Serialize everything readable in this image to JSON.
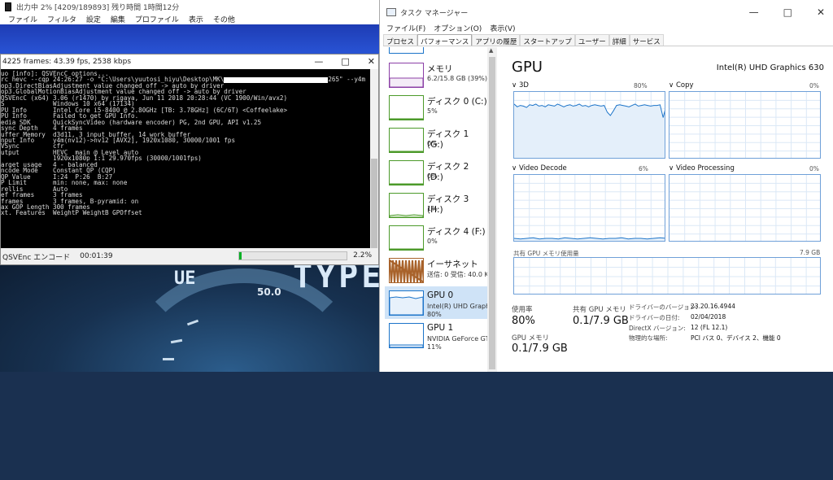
{
  "player": {
    "title": "出力中 2% [4209/189893] 残り時間 1時間12分",
    "menu": [
      "ファイル",
      "フィルタ",
      "設定",
      "編集",
      "プロファイル",
      "表示",
      "その他"
    ]
  },
  "background": {
    "overlay_text_1": "TYPE",
    "overlay_text_2": "UE",
    "gauge_labels": [
      "50.0"
    ]
  },
  "console": {
    "title": "4225 frames: 43.39 fps, 2538 kbps",
    "lines": [
      "uo [info]: QSVEncC options...",
      "rc hevc --cqp 24:26:27 -o \"C:\\Users\\yuutosi_hiyu\\Desktop\\MK\\",
      "op3.DirectBiasAdjustment value changed off -> auto by driver",
      "op3.GlobalMotionBiasAdjustment value changed off -> auto by driver",
      "QSVEncC (x64) 3.06 (r1470) by rigaya, Jun 11 2018 20:28:44 (VC 1900/Win/avx2)",
      "S             Windows 10 x64 (17134)",
      "PU Info       Intel Core i5-8400 @ 2.80GHz [TB: 3.78GHz] (6C/6T) <Coffeelake>",
      "PU Info       Failed to get GPU Info.",
      "edia SDK      QuickSyncVideo (hardware encoder) PG, 2nd GPU, API v1.25",
      "sync Depth    4 frames",
      "uffer Memory  d3d11, 3 input buffer, 14 work buffer",
      "nput Info     y4m(nv12)->nv12 [AVX2], 1920x1080, 30000/1001 fps",
      "VSync         cfr",
      "utput         HEVC  main @ Level auto",
      "              1920x1080p 1:1 29.970fps (30000/1001fps)",
      "arget usage   4 - balanced",
      "ncode Mode    Constant QP (CQP)",
      "QP Value      I:24  P:26  B:27",
      "P Limit       min: none, max: none",
      "rellis        Auto",
      "ef frames     3 frames",
      "frames        3 frames, B-pyramid: on",
      "ax GOP Length 300 frames",
      "xt. Features  WeightP WeightB GPOffset"
    ],
    "redacted_suffix": "265\" --y4m -i -",
    "status_label": "QSVEnc エンコード",
    "elapsed": "00:01:39",
    "progress_pct": 0.022,
    "progress_text": "2.2%"
  },
  "taskmgr": {
    "title": "タスク マネージャー",
    "menu": [
      "ファイル(F)",
      "オプション(O)",
      "表示(V)"
    ],
    "tabs": [
      "プロセス",
      "パフォーマンス",
      "アプリの履歴",
      "スタートアップ",
      "ユーザー",
      "詳細",
      "サービス"
    ],
    "active_tab": 1,
    "sidebar": [
      {
        "name": "メモリ",
        "sub": "6.2/15.8 GB (39%)",
        "sub2": "",
        "kind": "mem"
      },
      {
        "name": "ディスク 0 (C:)",
        "sub": "5%",
        "sub2": "",
        "kind": "disk"
      },
      {
        "name": "ディスク 1 (G:)",
        "sub": "0%",
        "sub2": "",
        "kind": "disk"
      },
      {
        "name": "ディスク 2 (D:)",
        "sub": "0%",
        "sub2": "",
        "kind": "disk"
      },
      {
        "name": "ディスク 3 (H:)",
        "sub": "1%",
        "sub2": "",
        "kind": "disk"
      },
      {
        "name": "ディスク 4 (F:)",
        "sub": "0%",
        "sub2": "",
        "kind": "disk"
      },
      {
        "name": "イーサネット",
        "sub": "送信: 0 受信: 40.0 Kb",
        "sub2": "",
        "kind": "eth"
      },
      {
        "name": "GPU 0",
        "sub": "Intel(R) UHD Graphic",
        "sub2": "80%",
        "kind": "gpu"
      },
      {
        "name": "GPU 1",
        "sub": "NVIDIA GeForce GTX",
        "sub2": "11%",
        "kind": "gpu"
      }
    ],
    "selected_index": 7,
    "main": {
      "title": "GPU",
      "model": "Intel(R) UHD Graphics 630",
      "engines": [
        {
          "label": "3D",
          "pct": "80%",
          "level": 0.8
        },
        {
          "label": "Copy",
          "pct": "0%",
          "level": 0
        },
        {
          "label": "Video Decode",
          "pct": "6%",
          "level": 0.06
        },
        {
          "label": "Video Processing",
          "pct": "0%",
          "level": 0
        }
      ],
      "shared_mem_label": "共有 GPU メモリ使用量",
      "shared_mem_max": "7.9 GB",
      "stats": {
        "util_label": "使用率",
        "util_value": "80%",
        "shared_label": "共有 GPU メモリ",
        "shared_value": "0.1/7.9 GB",
        "gpumem_label": "GPU メモリ",
        "gpumem_value": "0.1/7.9 GB"
      },
      "details": [
        {
          "k": "ドライバーのバージョン:",
          "v": "23.20.16.4944"
        },
        {
          "k": "ドライバーの日付:",
          "v": "02/04/2018"
        },
        {
          "k": "DirectX バージョン:",
          "v": "12 (FL 12.1)"
        },
        {
          "k": "物理的な場所:",
          "v": "PCI バス 0、デバイス 2、機能 0"
        }
      ],
      "graph_3d_series": [
        0.82,
        0.78,
        0.8,
        0.79,
        0.77,
        0.81,
        0.8,
        0.82,
        0.79,
        0.8,
        0.78,
        0.81,
        0.8,
        0.79,
        0.82,
        0.8,
        0.78,
        0.8,
        0.81,
        0.79,
        0.8,
        0.82,
        0.79,
        0.8,
        0.78,
        0.8,
        0.81,
        0.8,
        0.79,
        0.8,
        0.7,
        0.65,
        0.72,
        0.8,
        0.81,
        0.8,
        0.79,
        0.78,
        0.8,
        0.82,
        0.79,
        0.8,
        0.81,
        0.8,
        0.79,
        0.8,
        0.8,
        0.81,
        0.62,
        0.8
      ],
      "graph_vd_series": [
        0.06,
        0.05,
        0.06,
        0.07,
        0.05,
        0.06,
        0.06,
        0.05,
        0.07,
        0.06,
        0.05,
        0.06,
        0.07,
        0.06,
        0.05,
        0.06,
        0.06,
        0.07,
        0.05,
        0.06,
        0.06,
        0.05,
        0.06,
        0.07,
        0.06
      ]
    }
  }
}
